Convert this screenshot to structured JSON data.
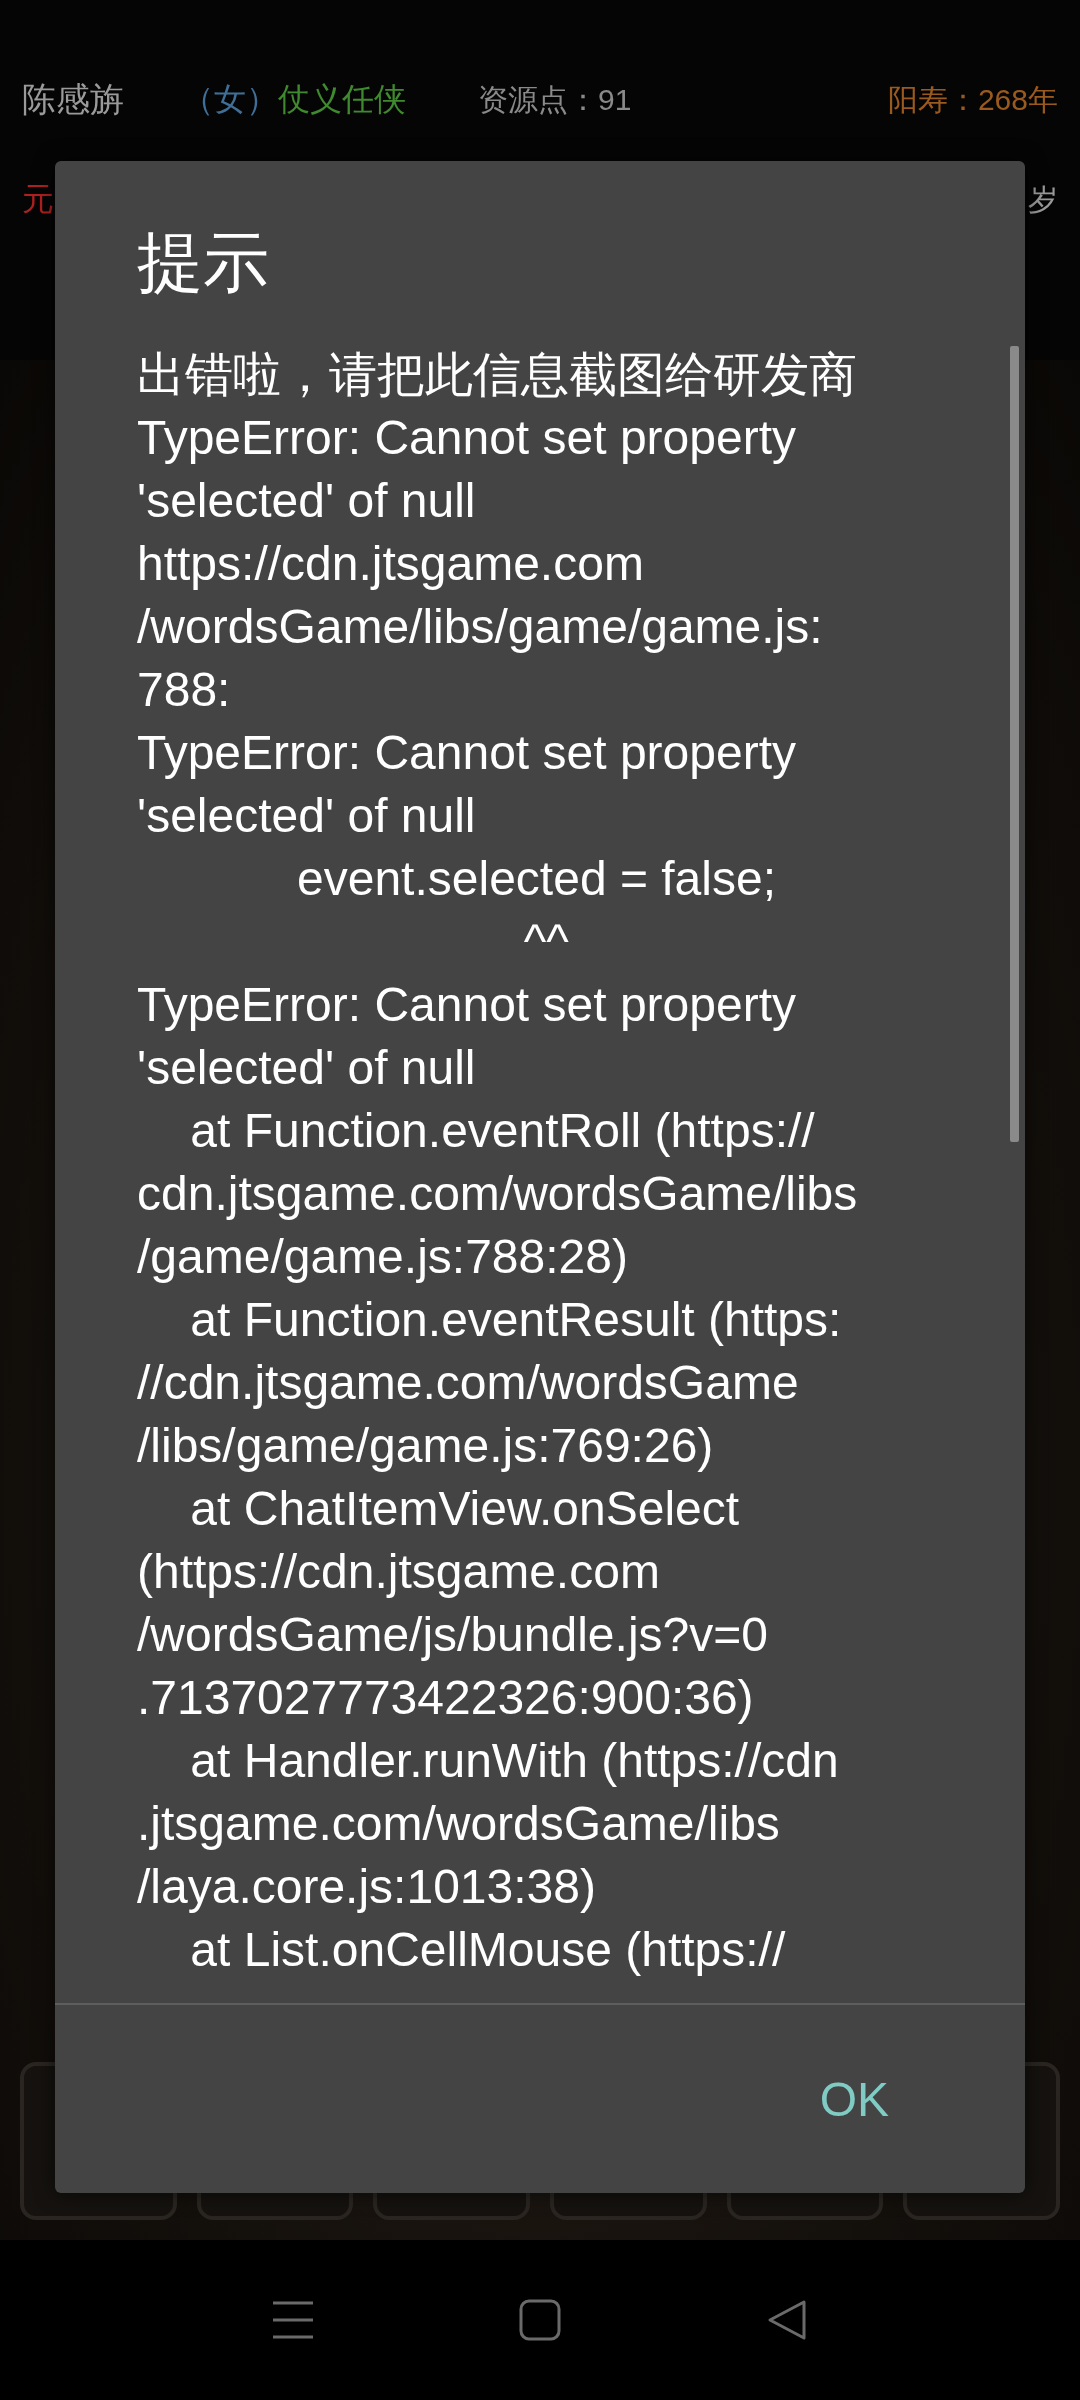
{
  "header": {
    "name": "陈感旃",
    "gender": "（女）",
    "title": "仗义任侠",
    "resources": "资源点：91",
    "lifespan": "阳寿：268年",
    "row2_left": "元",
    "row2_right": "岁"
  },
  "game_buttons": [
    {
      "kind": "tile"
    },
    {
      "kind": "tile"
    },
    {
      "kind": "tile"
    },
    {
      "kind": "tile"
    },
    {
      "kind": "tile"
    },
    {
      "kind": "tile"
    }
  ],
  "dialog": {
    "title": "提示",
    "message_lines": [
      "出错啦，请把此信息截图给研发商",
      "TypeError: Cannot set property",
      "'selected' of null",
      "https://cdn.jtsgame.com",
      "/wordsGame/libs/game/game.js:",
      "788:",
      "TypeError: Cannot set property",
      "'selected' of null",
      "            event.selected = false;",
      "                             ^^",
      "TypeError: Cannot set property",
      "'selected' of null",
      "    at Function.eventRoll (https://",
      "cdn.jtsgame.com/wordsGame/libs",
      "/game/game.js:788:28)",
      "    at Function.eventResult (https:",
      "//cdn.jtsgame.com/wordsGame",
      "/libs/game/game.js:769:26)",
      "    at ChatItemView.onSelect",
      "(https://cdn.jtsgame.com",
      "/wordsGame/js/bundle.js?v=0",
      ".7137027773422326:900:36)",
      "    at Handler.runWith (https://cdn",
      ".jtsgame.com/wordsGame/libs",
      "/laya.core.js:1013:38)",
      "    at List.onCellMouse (https://"
    ],
    "button": "OK"
  },
  "nav_bar": [
    {
      "kind": "menu"
    },
    {
      "kind": "home"
    },
    {
      "kind": "back"
    }
  ]
}
